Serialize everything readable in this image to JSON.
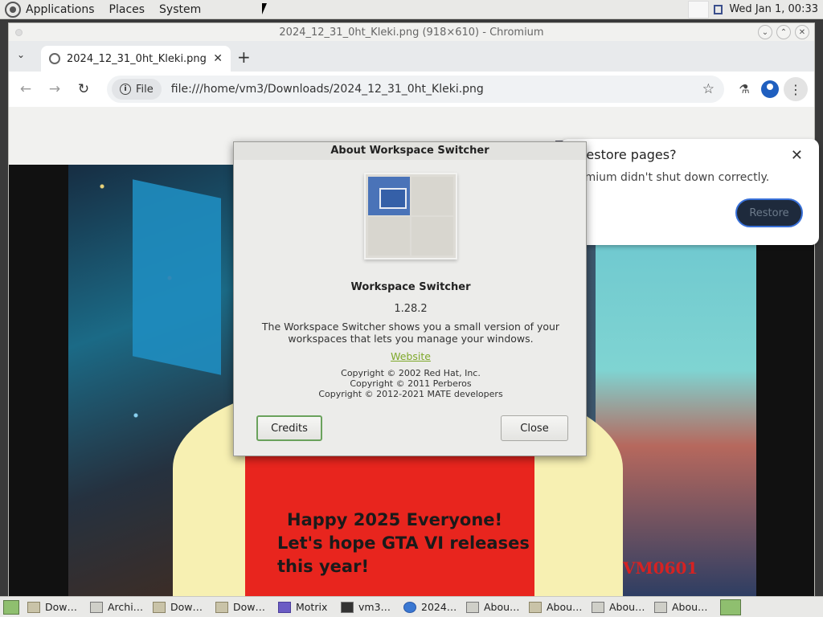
{
  "topbar": {
    "menus": [
      "Applications",
      "Places",
      "System"
    ],
    "clock": "Wed Jan  1, 00:33"
  },
  "window": {
    "title": "2024_12_31_0ht_Kleki.png (918×610) - Chromium"
  },
  "browser": {
    "tab_title": "2024_12_31_0ht_Kleki.png",
    "chip_label": "File",
    "url": "file:///home/vm3/Downloads/2024_12_31_0ht_Kleki.png"
  },
  "image": {
    "line1": "Happy 2025 Everyone!",
    "line2": "Let's hope GTA VI releases",
    "line3": "this year!",
    "signature": "VM0601"
  },
  "restore_popup": {
    "title": "Restore pages?",
    "body": "omium didn't shut down correctly.",
    "button": "Restore"
  },
  "about_dialog": {
    "title": "About Workspace Switcher",
    "name": "Workspace Switcher",
    "version": "1.28.2",
    "description": "The Workspace Switcher shows you a small version of your workspaces that lets you manage your windows.",
    "website": "Website",
    "copyright": [
      "Copyright © 2002 Red Hat, Inc.",
      "Copyright © 2011 Perberos",
      "Copyright © 2012-2021 MATE developers"
    ],
    "credits_button": "Credits",
    "close_button": "Close"
  },
  "taskbar": {
    "items": [
      {
        "label": "Dow…",
        "icon": "folder-icon"
      },
      {
        "label": "Archi…",
        "icon": "archive-icon"
      },
      {
        "label": "Dow…",
        "icon": "folder-icon"
      },
      {
        "label": "Dow…",
        "icon": "folder-icon"
      },
      {
        "label": "Motrix",
        "icon": "motrix-icon"
      },
      {
        "label": "vm3…",
        "icon": "terminal-icon"
      },
      {
        "label": "2024…",
        "icon": "chromium-icon"
      },
      {
        "label": "Abou…",
        "icon": "about-icon"
      },
      {
        "label": "Abou…",
        "icon": "folder-icon"
      },
      {
        "label": "Abou…",
        "icon": "about-icon"
      },
      {
        "label": "Abou…",
        "icon": "workspace-icon"
      }
    ]
  }
}
